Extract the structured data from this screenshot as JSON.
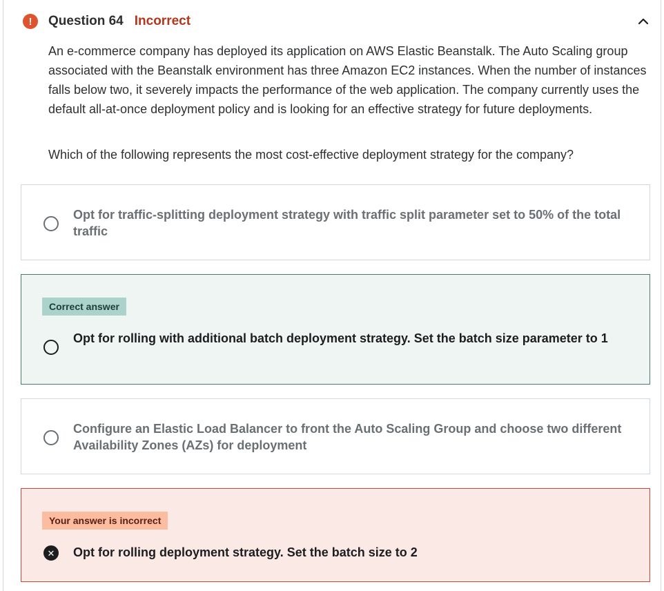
{
  "header": {
    "alert_icon": "exclamation-icon",
    "alert_glyph": "!",
    "alert_color": "#e0532f",
    "question_title": "Question 64",
    "status": "Incorrect",
    "status_color": "#b4361c",
    "collapse_icon": "chevron-up-icon"
  },
  "question": {
    "text": "An e-commerce company has deployed its application on AWS Elastic Beanstalk. The Auto Scaling group associated with the Beanstalk environment has three Amazon EC2 instances. When the number of instances falls below two, it severely impacts the performance of the web application. The company currently uses the default all-at-once deployment policy and is looking for an effective strategy for future deployments.",
    "prompt": "Which of the following represents the most cost-effective deployment strategy for the company?"
  },
  "options": [
    {
      "text": "Opt for traffic-splitting deployment strategy with traffic split parameter set to 50% of the total traffic",
      "state": "unselected"
    },
    {
      "badge": "Correct answer",
      "text": "Opt for rolling with additional batch deployment strategy. Set the batch size parameter to 1",
      "state": "correct"
    },
    {
      "text": "Configure an Elastic Load Balancer to front the Auto Scaling Group and choose two different Availability Zones (AZs) for deployment",
      "state": "unselected"
    },
    {
      "badge": "Your answer is incorrect",
      "text": "Opt for rolling deployment strategy. Set the batch size to 2",
      "state": "selected-incorrect",
      "mark_glyph": "✕"
    }
  ]
}
